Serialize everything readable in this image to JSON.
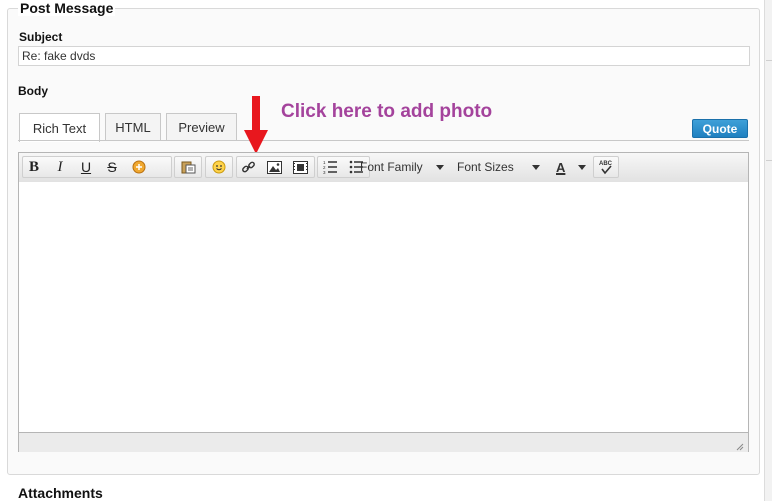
{
  "form": {
    "legend": "Post Message",
    "subject_label": "Subject",
    "subject_value": "Re: fake dvds",
    "body_label": "Body"
  },
  "tabs": [
    {
      "label": "Rich Text",
      "active": true
    },
    {
      "label": "HTML",
      "active": false
    },
    {
      "label": "Preview",
      "active": false
    }
  ],
  "annotation": {
    "text": "Click here to add photo",
    "color": "#a4439c",
    "arrow_color": "#e8171e"
  },
  "quote_button": {
    "label": "Quote",
    "color": "#2b8fd0"
  },
  "toolbar": {
    "bold_label": "B",
    "italic_label": "I",
    "underline_label": "U",
    "strike_label": "S",
    "font_family_label": "Font Family",
    "font_sizes_label": "Font Sizes",
    "font_color_label": "A",
    "spellcheck_label": "ABC",
    "icons": [
      "bold-icon",
      "italic-icon",
      "underline-icon",
      "strikethrough-icon",
      "clear-format-icon",
      "paste-icon",
      "emoticon-icon",
      "link-icon",
      "image-icon",
      "video-icon",
      "numbered-list-icon",
      "bullet-list-icon",
      "font-color-icon",
      "spellcheck-icon"
    ]
  },
  "attachments": {
    "title": "Attachments"
  }
}
